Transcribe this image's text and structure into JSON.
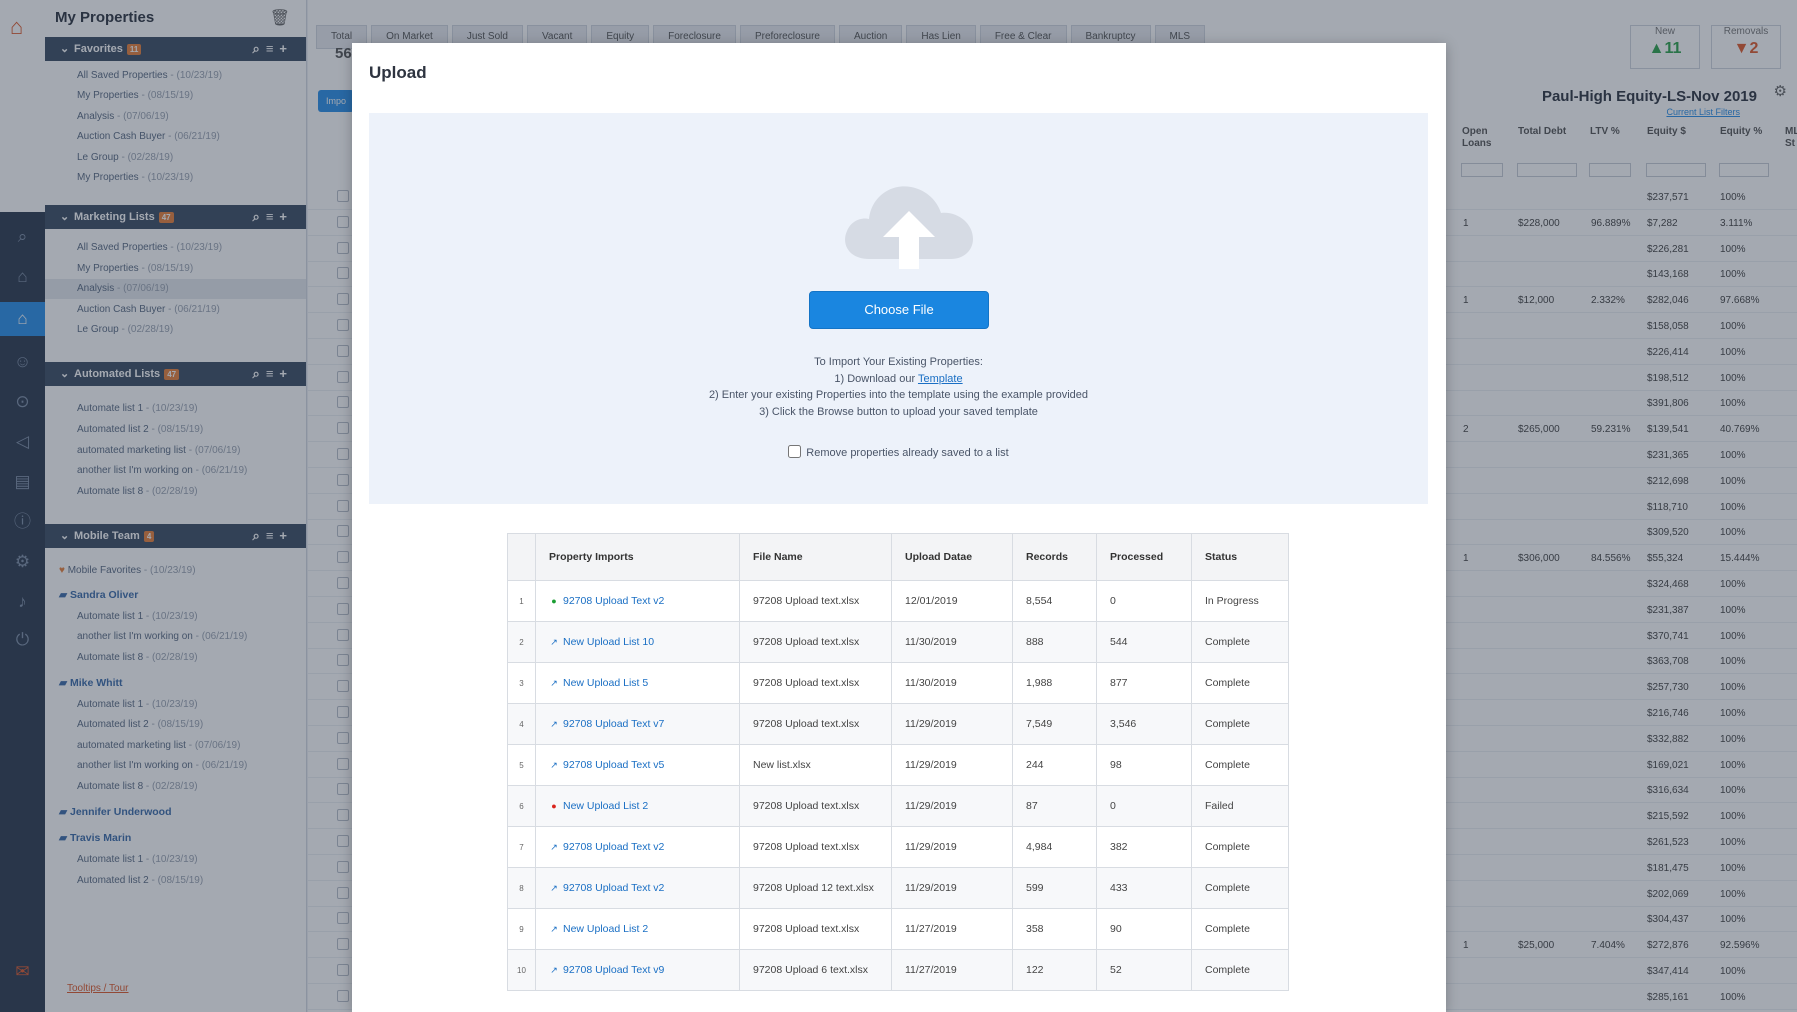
{
  "sidebar": {
    "title": "My Properties",
    "favorites": {
      "label": "Favorites",
      "count": "11",
      "items": [
        {
          "name": "All Saved Properties",
          "date": " - (10/23/19)"
        },
        {
          "name": "My Properties",
          "date": " - (08/15/19)"
        },
        {
          "name": "Analysis",
          "date": " - (07/06/19)"
        },
        {
          "name": "Auction Cash Buyer",
          "date": " - (06/21/19)"
        },
        {
          "name": "Le Group",
          "date": " - (02/28/19)"
        },
        {
          "name": "My Properties",
          "date": " - (10/23/19)"
        }
      ]
    },
    "marketing": {
      "label": "Marketing Lists",
      "count": "47",
      "items": [
        {
          "name": "All Saved Properties",
          "date": " - (10/23/19)"
        },
        {
          "name": "My Properties",
          "date": " - (08/15/19)"
        },
        {
          "name": "Analysis",
          "date": " - (07/06/19)"
        },
        {
          "name": "Auction Cash Buyer",
          "date": " - (06/21/19)"
        },
        {
          "name": "Le Group",
          "date": " - (02/28/19)"
        }
      ]
    },
    "automated": {
      "label": "Automated Lists",
      "count": "47",
      "items": [
        {
          "name": "Automate list 1",
          "date": " - (10/23/19)"
        },
        {
          "name": "Automated list 2",
          "date": " - (08/15/19)"
        },
        {
          "name": "automated marketing list",
          "date": " - (07/06/19)"
        },
        {
          "name": "another list I'm working on",
          "date": " - (06/21/19)"
        },
        {
          "name": "Automate list 8",
          "date": " - (02/28/19)"
        }
      ]
    },
    "mobile": {
      "label": "Mobile Team",
      "count": "4",
      "favorites": {
        "name": "Mobile Favorites",
        "date": " - (10/23/19)"
      },
      "members": [
        {
          "name": "Sandra Oliver",
          "items": [
            {
              "name": "Automate list 1",
              "date": " - (10/23/19)"
            },
            {
              "name": "another list I'm working on",
              "date": " - (06/21/19)"
            },
            {
              "name": "Automate list 8",
              "date": " - (02/28/19)"
            }
          ]
        },
        {
          "name": "Mike Whitt",
          "items": [
            {
              "name": "Automate list 1",
              "date": " - (10/23/19)"
            },
            {
              "name": "Automated list 2",
              "date": " - (08/15/19)"
            },
            {
              "name": "automated marketing list",
              "date": " - (07/06/19)"
            },
            {
              "name": "another list I'm working on",
              "date": " - (06/21/19)"
            },
            {
              "name": "Automate list 8",
              "date": " - (02/28/19)"
            }
          ]
        },
        {
          "name": "Jennifer Underwood",
          "items": []
        },
        {
          "name": "Travis Marin",
          "items": [
            {
              "name": "Automate list 1",
              "date": " - (10/23/19)"
            },
            {
              "name": "Automated list 2",
              "date": " - (08/15/19)"
            }
          ]
        }
      ]
    },
    "footer_link": "Tooltips / Tour"
  },
  "background": {
    "tabs": [
      "Total",
      "On Market",
      "Just Sold",
      "Vacant",
      "Equity",
      "Foreclosure",
      "Preforeclosure",
      "Auction",
      "Has Lien",
      "Free & Clear",
      "Bankruptcy",
      "MLS"
    ],
    "total_value": "56",
    "new": {
      "label": "New",
      "value": "11"
    },
    "removals": {
      "label": "Removals",
      "value": "2"
    },
    "list_title": "Paul-High Equity-LS-Nov 2019",
    "filters_link": "Current List Filters",
    "import_btn": "Impo",
    "columns": {
      "open_loans": "Open Loans",
      "total_debt": "Total Debt",
      "ltv": "LTV %",
      "equity_amt": "Equity $",
      "equity_pct": "Equity %",
      "mls": "ML St"
    },
    "rows": [
      {
        "loans": "",
        "debt": "",
        "ltv": "",
        "eq": "$237,571",
        "pct": "100%"
      },
      {
        "loans": "1",
        "debt": "$228,000",
        "ltv": "96.889%",
        "eq": "$7,282",
        "pct": "3.111%"
      },
      {
        "loans": "",
        "debt": "",
        "ltv": "",
        "eq": "$226,281",
        "pct": "100%"
      },
      {
        "loans": "",
        "debt": "",
        "ltv": "",
        "eq": "$143,168",
        "pct": "100%"
      },
      {
        "loans": "1",
        "debt": "$12,000",
        "ltv": "2.332%",
        "eq": "$282,046",
        "pct": "97.668%"
      },
      {
        "loans": "",
        "debt": "",
        "ltv": "",
        "eq": "$158,058",
        "pct": "100%"
      },
      {
        "loans": "",
        "debt": "",
        "ltv": "",
        "eq": "$226,414",
        "pct": "100%"
      },
      {
        "loans": "",
        "debt": "",
        "ltv": "",
        "eq": "$198,512",
        "pct": "100%"
      },
      {
        "loans": "",
        "debt": "",
        "ltv": "",
        "eq": "$391,806",
        "pct": "100%"
      },
      {
        "loans": "2",
        "debt": "$265,000",
        "ltv": "59.231%",
        "eq": "$139,541",
        "pct": "40.769%"
      },
      {
        "loans": "",
        "debt": "",
        "ltv": "",
        "eq": "$231,365",
        "pct": "100%"
      },
      {
        "loans": "",
        "debt": "",
        "ltv": "",
        "eq": "$212,698",
        "pct": "100%"
      },
      {
        "loans": "",
        "debt": "",
        "ltv": "",
        "eq": "$118,710",
        "pct": "100%"
      },
      {
        "loans": "",
        "debt": "",
        "ltv": "",
        "eq": "$309,520",
        "pct": "100%"
      },
      {
        "loans": "1",
        "debt": "$306,000",
        "ltv": "84.556%",
        "eq": "$55,324",
        "pct": "15.444%"
      },
      {
        "loans": "",
        "debt": "",
        "ltv": "",
        "eq": "$324,468",
        "pct": "100%"
      },
      {
        "loans": "",
        "debt": "",
        "ltv": "",
        "eq": "$231,387",
        "pct": "100%"
      },
      {
        "loans": "",
        "debt": "",
        "ltv": "",
        "eq": "$370,741",
        "pct": "100%"
      },
      {
        "loans": "",
        "debt": "",
        "ltv": "",
        "eq": "$363,708",
        "pct": "100%"
      },
      {
        "loans": "",
        "debt": "",
        "ltv": "",
        "eq": "$257,730",
        "pct": "100%"
      },
      {
        "loans": "",
        "debt": "",
        "ltv": "",
        "eq": "$216,746",
        "pct": "100%"
      },
      {
        "loans": "",
        "debt": "",
        "ltv": "",
        "eq": "$332,882",
        "pct": "100%"
      },
      {
        "loans": "",
        "debt": "",
        "ltv": "",
        "eq": "$169,021",
        "pct": "100%"
      },
      {
        "loans": "",
        "debt": "",
        "ltv": "",
        "eq": "$316,634",
        "pct": "100%"
      },
      {
        "loans": "",
        "debt": "",
        "ltv": "",
        "eq": "$215,592",
        "pct": "100%"
      },
      {
        "loans": "",
        "debt": "",
        "ltv": "",
        "eq": "$261,523",
        "pct": "100%"
      },
      {
        "loans": "",
        "debt": "",
        "ltv": "",
        "eq": "$181,475",
        "pct": "100%"
      },
      {
        "loans": "",
        "debt": "",
        "ltv": "",
        "eq": "$202,069",
        "pct": "100%"
      },
      {
        "loans": "",
        "debt": "",
        "ltv": "",
        "eq": "$304,437",
        "pct": "100%"
      },
      {
        "loans": "1",
        "debt": "$25,000",
        "ltv": "7.404%",
        "eq": "$272,876",
        "pct": "92.596%"
      },
      {
        "loans": "",
        "debt": "",
        "ltv": "",
        "eq": "$347,414",
        "pct": "100%"
      },
      {
        "loans": "",
        "debt": "",
        "ltv": "",
        "eq": "$285,161",
        "pct": "100%"
      }
    ]
  },
  "modal": {
    "title": "Upload",
    "choose_file": "Choose File",
    "instructions": {
      "heading": "To Import Your Existing Properties:",
      "step1_prefix": "1) Download our ",
      "step1_link": "Template",
      "step2": "2) Enter your existing Properties into the template using the example provided",
      "step3": "3) Click the Browse button to upload your saved template"
    },
    "remove_checkbox_label": "Remove properties already saved to a list",
    "table": {
      "headers": [
        "Property Imports",
        "File Name",
        "Upload Datae",
        "Records",
        "Processed",
        "Status"
      ],
      "rows": [
        {
          "num": "1",
          "name": "92708 Upload Text v2",
          "file": "97208 Upload text.xlsx",
          "date": "12/01/2019",
          "records": "8,554",
          "processed": "0",
          "status": "In Progress",
          "icon": "green-dot"
        },
        {
          "num": "2",
          "name": "New Upload List 10",
          "file": "97208 Upload text.xlsx",
          "date": "11/30/2019",
          "records": "888",
          "processed": "544",
          "status": "Complete",
          "icon": "external-link"
        },
        {
          "num": "3",
          "name": "New Upload List 5",
          "file": "97208 Upload text.xlsx",
          "date": "11/30/2019",
          "records": "1,988",
          "processed": "877",
          "status": "Complete",
          "icon": "external-link"
        },
        {
          "num": "4",
          "name": "92708 Upload Text v7",
          "file": "97208 Upload text.xlsx",
          "date": "11/29/2019",
          "records": "7,549",
          "processed": "3,546",
          "status": "Complete",
          "icon": "external-link"
        },
        {
          "num": "5",
          "name": "92708 Upload Text v5",
          "file": "New list.xlsx",
          "date": "11/29/2019",
          "records": "244",
          "processed": "98",
          "status": "Complete",
          "icon": "external-link"
        },
        {
          "num": "6",
          "name": "New Upload List 2",
          "file": "97208 Upload text.xlsx",
          "date": "11/29/2019",
          "records": "87",
          "processed": "0",
          "status": "Failed",
          "icon": "red-dot"
        },
        {
          "num": "7",
          "name": "92708 Upload Text v2",
          "file": "97208 Upload text.xlsx",
          "date": "11/29/2019",
          "records": "4,984",
          "processed": "382",
          "status": "Complete",
          "icon": "external-link"
        },
        {
          "num": "8",
          "name": "92708 Upload Text v2",
          "file": "97208 Upload 12 text.xlsx",
          "date": "11/29/2019",
          "records": "599",
          "processed": "433",
          "status": "Complete",
          "icon": "external-link"
        },
        {
          "num": "9",
          "name": "New Upload List 2",
          "file": "97208 Upload text.xlsx",
          "date": "11/27/2019",
          "records": "358",
          "processed": "90",
          "status": "Complete",
          "icon": "external-link"
        },
        {
          "num": "10",
          "name": "92708 Upload Text v9",
          "file": "97208 Upload 6 text.xlsx",
          "date": "11/27/2019",
          "records": "122",
          "processed": "52",
          "status": "Complete",
          "icon": "external-link"
        }
      ]
    }
  }
}
